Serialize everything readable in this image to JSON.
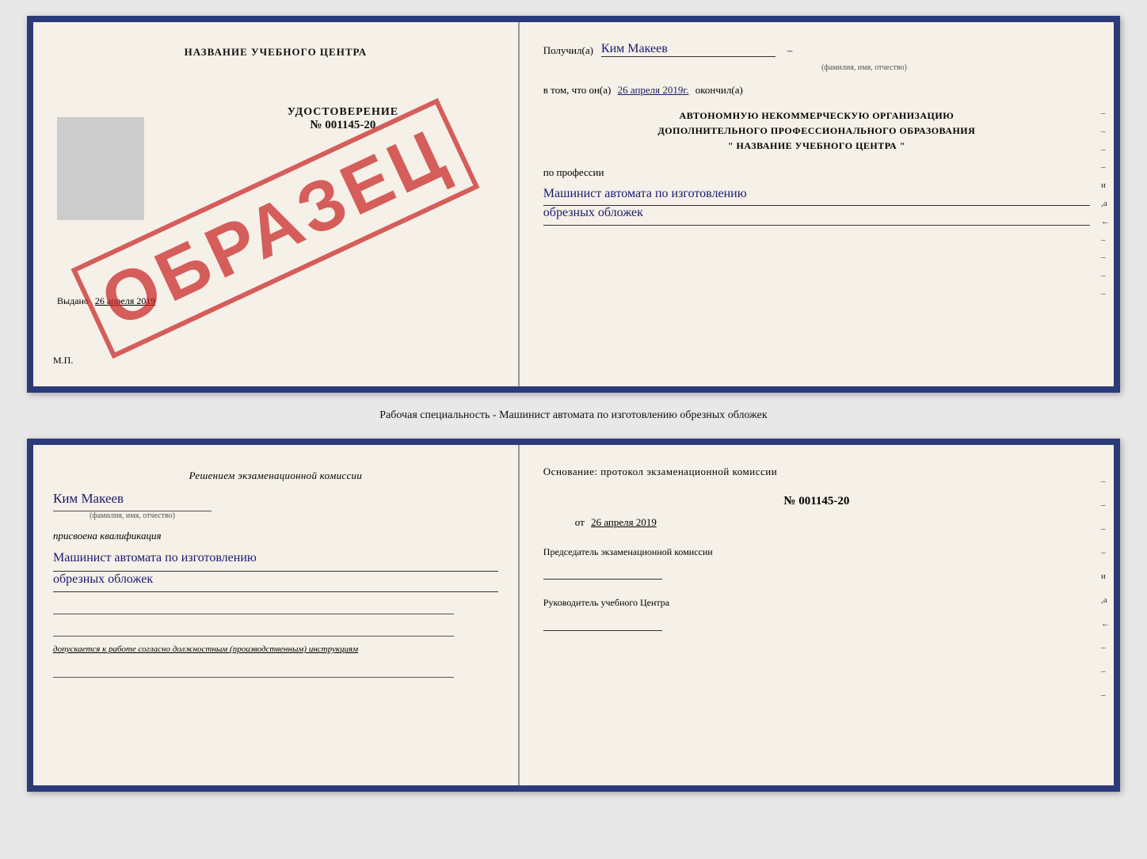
{
  "doc1": {
    "left": {
      "training_center": "НАЗВАНИЕ УЧЕБНОГО ЦЕНТРА",
      "cert_label": "УДОСТОВЕРЕНИЕ",
      "cert_number": "№ 001145-20",
      "issued_prefix": "Выдано",
      "issued_date": "26 апреля 2019",
      "mp_label": "М.П.",
      "watermark": "ОБРАЗЕЦ"
    },
    "right": {
      "received_prefix": "Получил(а)",
      "person_name": "Ким Макеев",
      "person_subtitle": "(фамилия, имя, отчество)",
      "date_prefix": "в том, что он(а)",
      "date_value": "26 апреля 2019г.",
      "date_suffix": "окончил(а)",
      "org_line1": "АВТОНОМНУЮ НЕКОММЕРЧЕСКУЮ ОРГАНИЗАЦИЮ",
      "org_line2": "ДОПОЛНИТЕЛЬНОГО ПРОФЕССИОНАЛЬНОГО ОБРАЗОВАНИЯ",
      "org_line3": "\"  НАЗВАНИЕ УЧЕБНОГО ЦЕНТРА  \"",
      "profession_label": "по профессии",
      "profession_line1": "Машинист автомата по изготовлению",
      "profession_line2": "обрезных обложек",
      "side_chars": [
        "–",
        "–",
        "–",
        "–",
        "и",
        ",а",
        "←",
        "–",
        "–",
        "–",
        "–"
      ]
    }
  },
  "speciality_caption": "Рабочая специальность - Машинист автомата по изготовлению обрезных обложек",
  "doc2": {
    "left": {
      "commission_text": "Решением экзаменационной комиссии",
      "person_name": "Ким Макеев",
      "person_subtitle": "(фамилия, имя, отчество)",
      "qualification_label": "присвоена квалификация",
      "qualification_line1": "Машинист автомата по изготовлению",
      "qualification_line2": "обрезных обложек",
      "allowed_text": "допускается к работе согласно должностным (производственным) инструкциям"
    },
    "right": {
      "basis_label": "Основание: протокол экзаменационной комиссии",
      "protocol_number": "№ 001145-20",
      "date_prefix": "от",
      "date_value": "26 апреля 2019",
      "chairman_label": "Председатель экзаменационной комиссии",
      "director_label": "Руководитель учебного Центра",
      "side_chars": [
        "–",
        "–",
        "–",
        "–",
        "и",
        ",а",
        "←",
        "–",
        "–",
        "–"
      ]
    }
  }
}
